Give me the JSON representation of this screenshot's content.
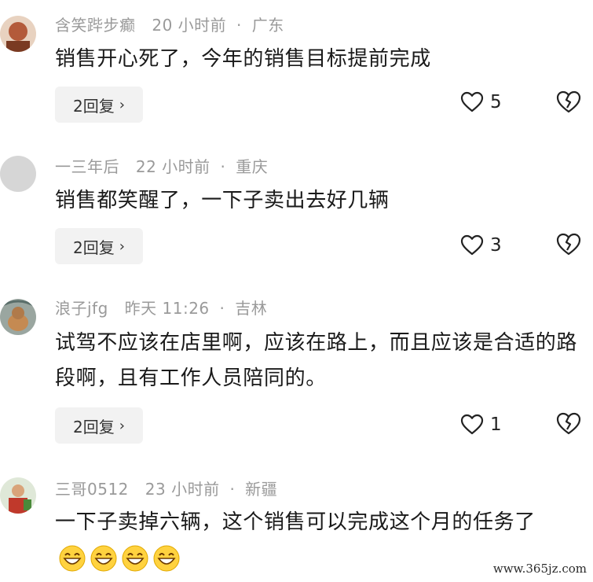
{
  "comments": [
    {
      "username": "含笑跸步癫",
      "time": "20 小时前",
      "location": "广东",
      "text": "销售开心死了，今年的销售目标提前完成",
      "replies_label": "2回复",
      "likes": "5",
      "avatar_color": "#b35a3a"
    },
    {
      "username": "一三年后",
      "time": "22 小时前",
      "location": "重庆",
      "text": "销售都笑醒了，一下子卖出去好几辆",
      "replies_label": "2回复",
      "likes": "3",
      "avatar_color": "#d6d6d6"
    },
    {
      "username": "浪子jfg",
      "time": "昨天 11:26",
      "location": "吉林",
      "text": "试驾不应该在店里啊，应该在路上，而且应该是合适的路段啊，且有工作人员陪同的。",
      "replies_label": "2回复",
      "likes": "1",
      "avatar_color": "#b07a4a"
    },
    {
      "username": "三哥0512",
      "time": "23 小时前",
      "location": "新疆",
      "text": "一下子卖掉六辆，这个销售可以完成这个月的任务了",
      "replies_label": "",
      "likes": "",
      "avatar_color": "#4a8a3a"
    }
  ],
  "separator": "·",
  "chevron": "›",
  "watermark": "www.365jz.com",
  "icons": {
    "like": "heart-outline-icon",
    "dislike": "broken-heart-icon",
    "emoji": "grinning-emoji-icon"
  }
}
